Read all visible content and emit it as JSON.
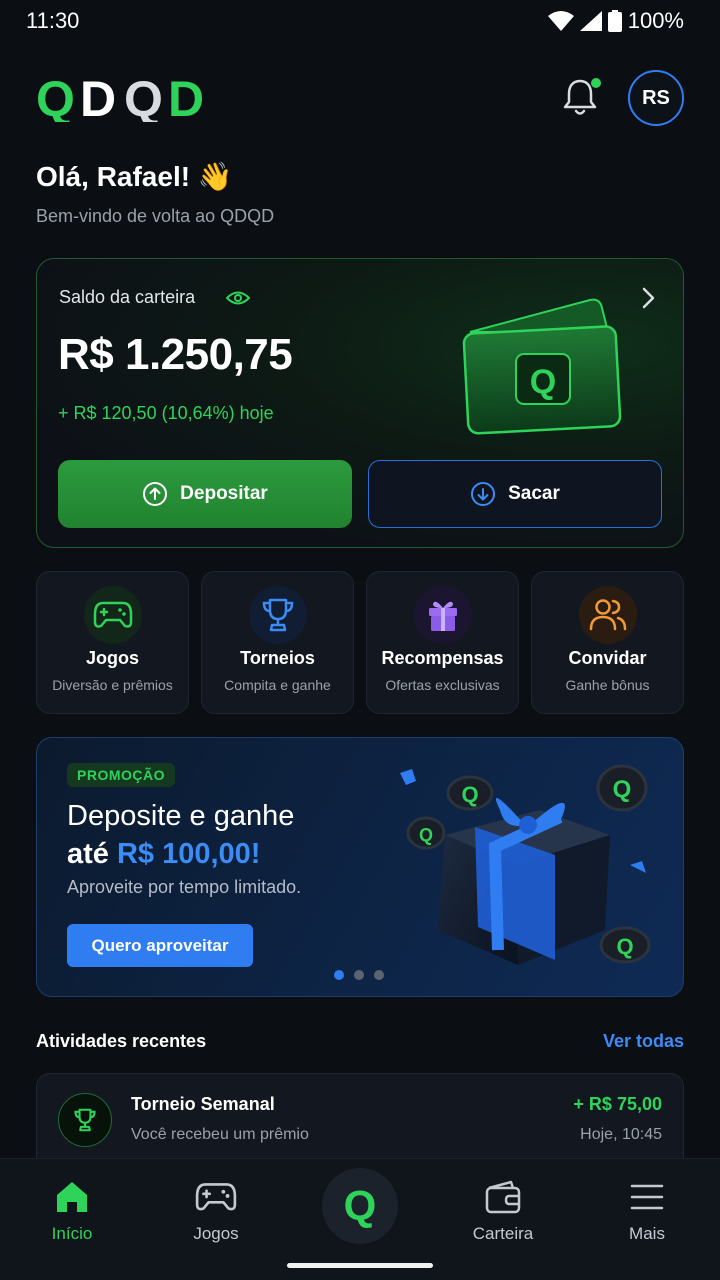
{
  "status_bar": {
    "time": "11:30",
    "battery": "100%"
  },
  "header": {
    "logo": "QDQD",
    "avatar_initials": "RS"
  },
  "greeting": {
    "title": "Olá, Rafael! 👋",
    "subtitle": "Bem-vindo de volta ao QDQD"
  },
  "wallet": {
    "label": "Saldo da carteira",
    "balance": "R$ 1.250,75",
    "change": "+ R$ 120,50 (10,64%) hoje",
    "deposit_label": "Depositar",
    "withdraw_label": "Sacar"
  },
  "quick_actions": [
    {
      "title": "Jogos",
      "subtitle": "Diversão e prêmios",
      "icon": "gamepad-icon"
    },
    {
      "title": "Torneios",
      "subtitle": "Compita e ganhe",
      "icon": "trophy-icon"
    },
    {
      "title": "Recompensas",
      "subtitle": "Ofertas exclusivas",
      "icon": "gift-icon"
    },
    {
      "title": "Convidar",
      "subtitle": "Ganhe bônus",
      "icon": "users-icon"
    }
  ],
  "promo": {
    "badge": "PROMOÇÃO",
    "title_line1": "Deposite e ganhe",
    "title_line2_prefix": "até ",
    "title_highlight": "R$ 100,00!",
    "subtitle": "Aproveite por tempo limitado.",
    "button": "Quero aproveitar",
    "pages": 3,
    "active_page": 1
  },
  "recent": {
    "title": "Atividades recentes",
    "see_all": "Ver todas",
    "items": [
      {
        "title": "Torneio Semanal",
        "subtitle": "Você recebeu um prêmio",
        "amount": "+ R$ 75,00",
        "time": "Hoje, 10:45",
        "icon": "trophy-icon"
      }
    ]
  },
  "bottom_nav": {
    "items": [
      {
        "label": "Início",
        "icon": "home-icon",
        "active": true
      },
      {
        "label": "Jogos",
        "icon": "gamepad-icon",
        "active": false
      },
      {
        "label": "",
        "icon": "q-logo-icon",
        "active": false
      },
      {
        "label": "Carteira",
        "icon": "wallet-icon",
        "active": false
      },
      {
        "label": "Mais",
        "icon": "menu-icon",
        "active": false
      }
    ]
  },
  "colors": {
    "accent_green": "#2fd35a",
    "accent_blue": "#2f7df0",
    "background": "#0b0e13"
  }
}
